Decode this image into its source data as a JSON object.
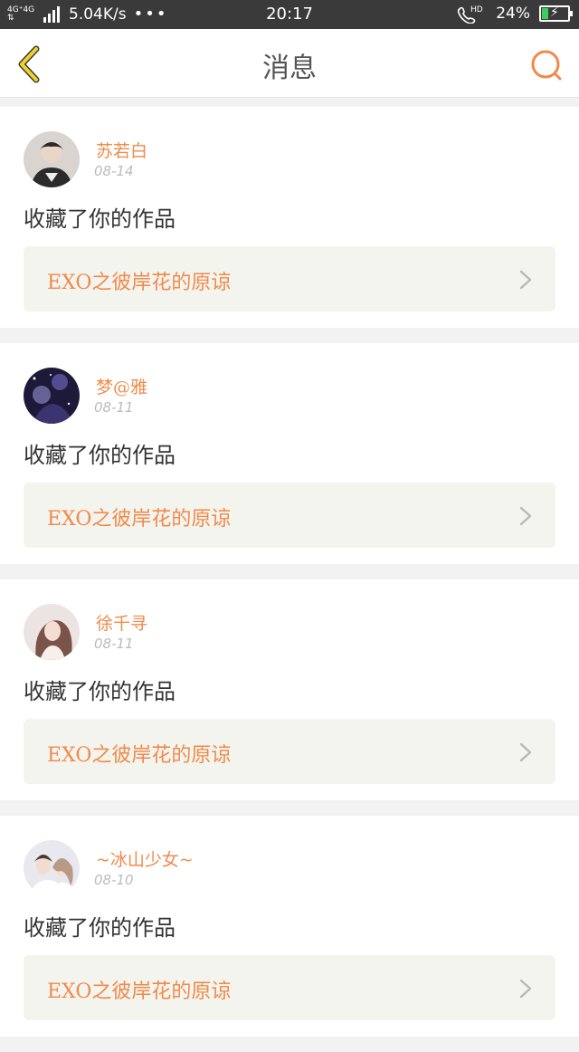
{
  "status_bar": {
    "network_badge_top": "4G⁺4G",
    "network_badge_bottom": "⇅",
    "speed": "5.04K/s",
    "dots": "•••",
    "time": "20:17",
    "hd_label": "HD",
    "battery": "24%"
  },
  "header": {
    "title": "消息"
  },
  "messages": [
    {
      "name": "苏若白",
      "date": "08-14",
      "action": "收藏了你的作品",
      "work": "EXO之彼岸花的原谅"
    },
    {
      "name": "梦@雅",
      "date": "08-11",
      "action": "收藏了你的作品",
      "work": "EXO之彼岸花的原谅"
    },
    {
      "name": "徐千寻",
      "date": "08-11",
      "action": "收藏了你的作品",
      "work": "EXO之彼岸花的原谅"
    },
    {
      "name": "~冰山少女~",
      "date": "08-10",
      "action": "收藏了你的作品",
      "work": "EXO之彼岸花的原谅"
    }
  ],
  "colors": {
    "accent": "#f08a4b",
    "back_icon": "#f0d22a",
    "status_bar_bg": "#3a3a3a"
  }
}
